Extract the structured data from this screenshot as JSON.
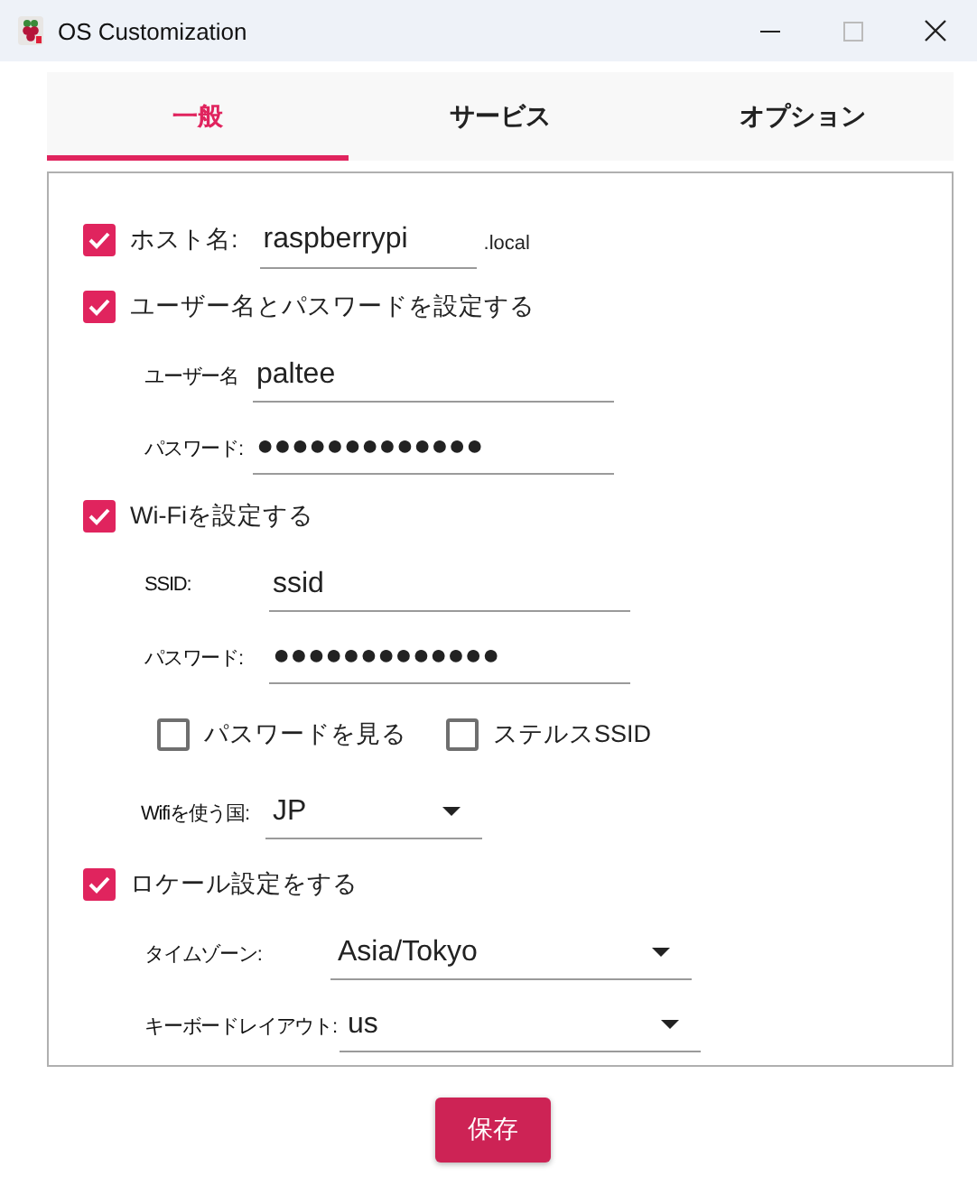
{
  "window": {
    "title": "OS Customization"
  },
  "tabs": [
    {
      "label": "一般",
      "selected": true
    },
    {
      "label": "サービス",
      "selected": false
    },
    {
      "label": "オプション",
      "selected": false
    }
  ],
  "rows": [
    {
      "kind": "check-field",
      "label": "ホスト名:",
      "checked": true,
      "value": "raspberrypi",
      "suffix": ".local"
    },
    {
      "kind": "check",
      "label": "ユーザー名とパスワードを設定する",
      "checked": true
    },
    {
      "kind": "field",
      "label": "ユーザー名",
      "value": "paltee"
    },
    {
      "kind": "field",
      "label": "パスワード:",
      "value": "●●●●●●●●●●●●●"
    },
    {
      "kind": "check",
      "label": "Wi-Fiを設定する",
      "checked": true
    },
    {
      "kind": "field",
      "label": "SSID:",
      "value": "ssid"
    },
    {
      "kind": "field",
      "label": "パスワード:",
      "value": "●●●●●●●●●●●●●"
    },
    {
      "kind": "checks",
      "items": [
        {
          "label": "パスワードを見る",
          "checked": false
        },
        {
          "label": "ステルスSSID",
          "checked": false
        }
      ]
    },
    {
      "kind": "select",
      "label": "Wifiを使う国:",
      "value": "JP"
    },
    {
      "kind": "check",
      "label": "ロケール設定をする",
      "checked": true
    },
    {
      "kind": "select",
      "label": "タイムゾーン:",
      "value": "Asia/Tokyo"
    },
    {
      "kind": "select",
      "label": "キーボードレイアウト:",
      "value": "us"
    }
  ],
  "save_button": "保存"
}
